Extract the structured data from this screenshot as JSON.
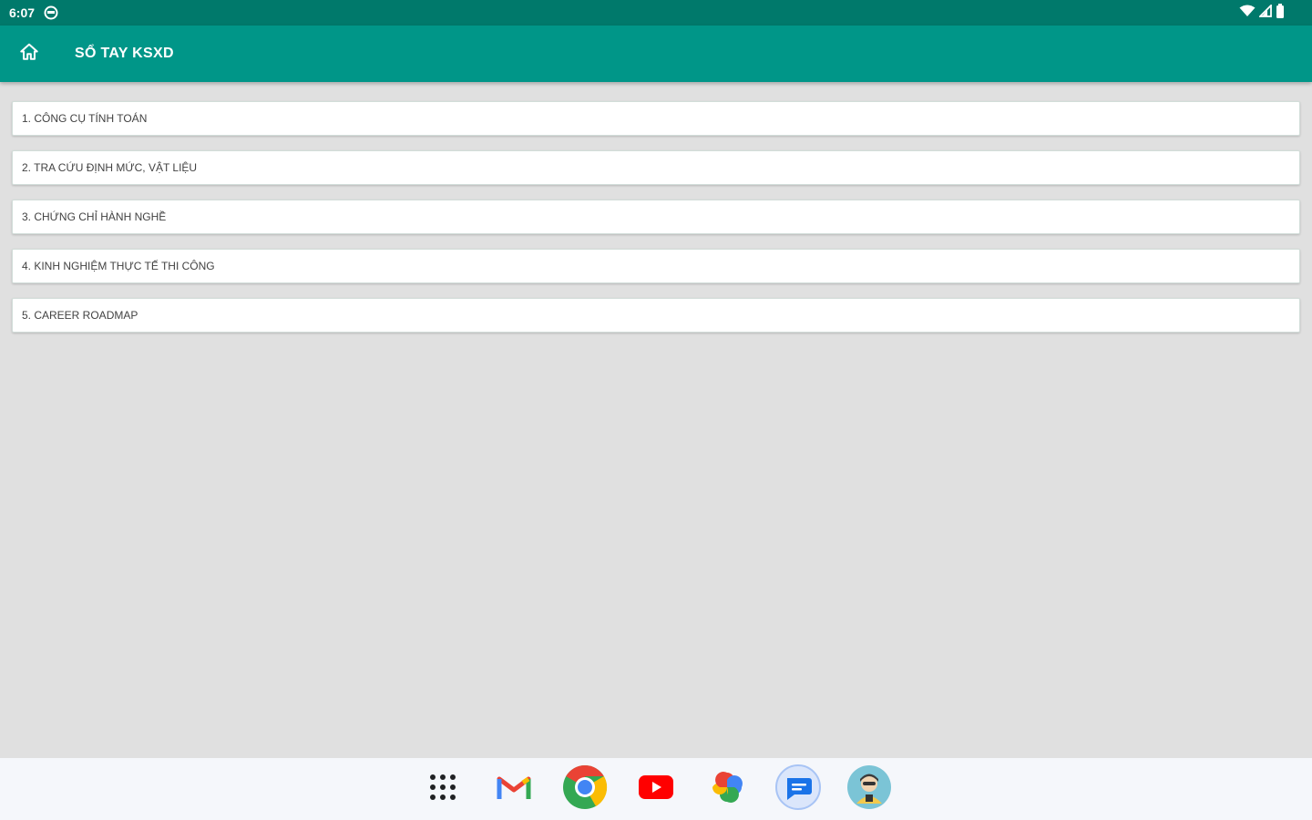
{
  "status_bar": {
    "time": "6:07"
  },
  "app_bar": {
    "title": "SỔ TAY KSXD",
    "icon": "home-icon"
  },
  "menu": {
    "items": [
      {
        "label": "1. CÔNG CỤ TÍNH TOÁN"
      },
      {
        "label": "2. TRA CỨU ĐỊNH MỨC, VẬT LIỆU"
      },
      {
        "label": "3. CHỨNG CHỈ HÀNH NGHỀ"
      },
      {
        "label": "4. KINH NGHIỆM THỰC TẾ THI CÔNG"
      },
      {
        "label": "5. CAREER ROADMAP"
      }
    ]
  },
  "taskbar": {
    "apps": [
      "app-drawer-icon",
      "gmail-icon",
      "chrome-icon",
      "youtube-icon",
      "photos-icon",
      "messages-icon",
      "assistant-app-icon"
    ]
  },
  "colors": {
    "status_bar": "#00796b",
    "app_bar": "#009688",
    "background": "#e0e0e0",
    "taskbar": "#f5f7fb"
  }
}
